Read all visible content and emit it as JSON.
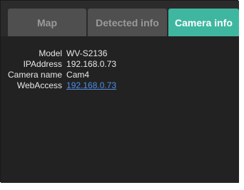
{
  "tabs": [
    {
      "label": "Map",
      "active": false
    },
    {
      "label": "Detected info",
      "active": false
    },
    {
      "label": "Camera info",
      "active": true
    }
  ],
  "camera_info": {
    "rows": [
      {
        "label": "Model",
        "value": "WV-S2136"
      },
      {
        "label": "IPAddress",
        "value": "192.168.0.73"
      },
      {
        "label": "Camera name",
        "value": "Cam4"
      },
      {
        "label": "WebAccess",
        "value": "192.168.0.73",
        "is_link": true
      }
    ]
  },
  "colors": {
    "active_tab": "#3fb7a0",
    "inactive_tab": "#4f4f4f",
    "panel_background": "#222222",
    "link": "#4f8fe6"
  }
}
